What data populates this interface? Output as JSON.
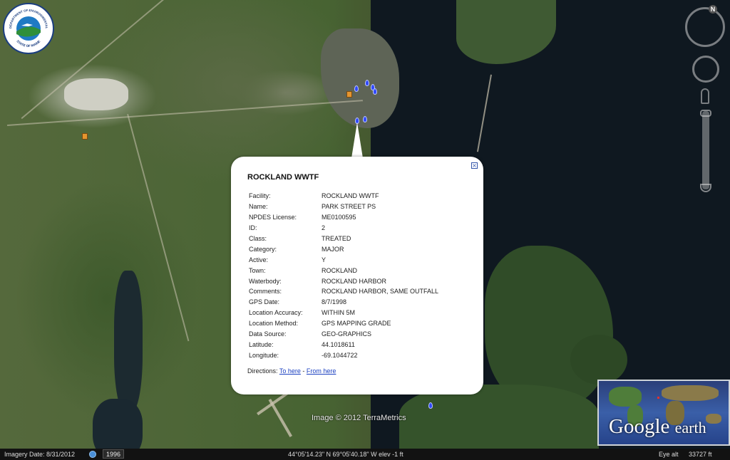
{
  "logo": {
    "name": "dep-logo",
    "top_text": "DEPARTMENT OF ENVIRONMENTAL PROTECTION",
    "bottom_text": "STATE OF MAINE"
  },
  "nav": {
    "north_label": "N"
  },
  "balloon": {
    "title": "ROCKLAND WWTF",
    "close_icon": "close-icon",
    "rows": [
      {
        "label": "Facility:",
        "value": "ROCKLAND WWTF"
      },
      {
        "label": "Name:",
        "value": "PARK STREET PS"
      },
      {
        "label": "NPDES License:",
        "value": "ME0100595"
      },
      {
        "label": "ID:",
        "value": "2"
      },
      {
        "label": "Class:",
        "value": "TREATED"
      },
      {
        "label": "Category:",
        "value": "MAJOR"
      },
      {
        "label": "Active:",
        "value": "Y"
      },
      {
        "label": "Town:",
        "value": "ROCKLAND"
      },
      {
        "label": "Waterbody:",
        "value": "ROCKLAND HARBOR"
      },
      {
        "label": "Comments:",
        "value": "ROCKLAND HARBOR, SAME OUTFALL"
      },
      {
        "label": "GPS Date:",
        "value": "8/7/1998"
      },
      {
        "label": "Location Accuracy:",
        "value": "WITHIN 5M"
      },
      {
        "label": "Location Method:",
        "value": "GPS MAPPING GRADE"
      },
      {
        "label": "Data Source:",
        "value": "GEO-GRAPHICS"
      },
      {
        "label": "Latitude:",
        "value": "44.1018611"
      },
      {
        "label": "Longitude:",
        "value": "-69.1044722"
      }
    ],
    "directions_label": "Directions:",
    "to_here": "To here",
    "separator": "-",
    "from_here": "From here"
  },
  "overlay": {
    "copyright": "Image © 2012 TerraMetrics",
    "brand_word1": "Google",
    "brand_word2": "earth"
  },
  "status": {
    "imagery_date": "Imagery Date: 8/31/2012",
    "historical_year": "1996",
    "coordinates": "44°05'14.23\" N  69°05'40.18\" W  elev   -1 ft",
    "eye_alt_label": "Eye alt",
    "eye_alt_value": "33727 ft"
  },
  "colors": {
    "placemark": "#2f47ff",
    "link": "#1a3fc0",
    "statusbar": "#121212"
  }
}
